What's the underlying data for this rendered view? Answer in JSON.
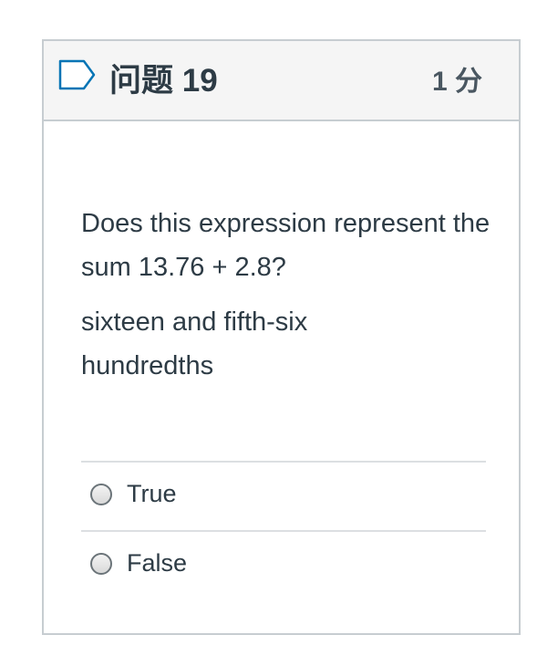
{
  "question": {
    "title": "问题 19",
    "points": "1 分",
    "flag_icon": "flag-icon",
    "text": "Does this expression represent the sum 13.76 + 2.8?",
    "expression": "sixteen and fifth-six hundredths"
  },
  "answers": [
    {
      "label": "True",
      "selected": false
    },
    {
      "label": "False",
      "selected": false
    }
  ],
  "colors": {
    "border": "#c7cdd1",
    "header_bg": "#f5f5f5",
    "text": "#2d3b45",
    "flag": "#0374b5"
  }
}
